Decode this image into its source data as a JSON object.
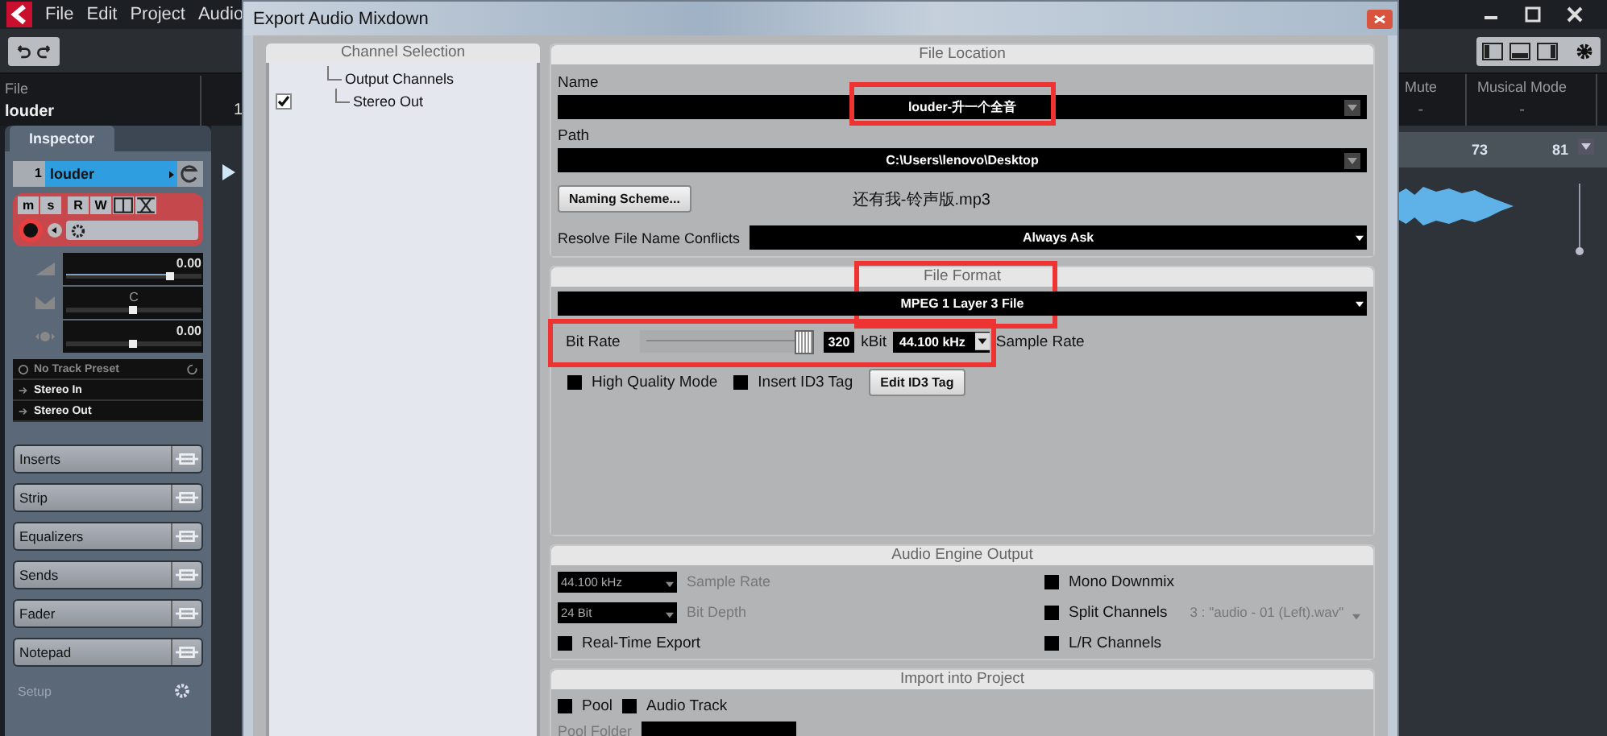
{
  "app": {
    "menu": [
      "File",
      "Edit",
      "Project",
      "Audio"
    ],
    "info": [
      {
        "label": "File",
        "value": "louder"
      }
    ],
    "info_partial": "1",
    "right_info": [
      {
        "label": "Mute",
        "value": "-"
      },
      {
        "label": "Musical Mode",
        "value": "-"
      }
    ],
    "ruler": [
      "73",
      "81"
    ],
    "inspector": {
      "tab": "Inspector",
      "track_number": "1",
      "track_name": "louder",
      "track_buttons": [
        "m",
        "s",
        "R",
        "W"
      ],
      "faders": [
        {
          "value": "0.00",
          "level": 0.77
        },
        {
          "value": "C",
          "level": 0.5
        },
        {
          "value": "0.00",
          "level": 0.5
        }
      ],
      "preset": "No Track Preset",
      "routing": [
        "Stereo In",
        "Stereo Out"
      ],
      "sections": [
        "Inserts",
        "Strip",
        "Equalizers",
        "Sends",
        "Fader",
        "Notepad"
      ],
      "setup": "Setup"
    }
  },
  "dialog": {
    "title": "Export Audio Mixdown",
    "channel_selection": {
      "title": "Channel Selection",
      "tree": [
        {
          "label": "Output Channels",
          "children": [
            {
              "label": "Stereo Out",
              "checked": true
            }
          ]
        }
      ]
    },
    "file_location": {
      "title": "File Location",
      "name_label": "Name",
      "name": "louder-升一个全音",
      "name_highlighted": true,
      "path_label": "Path",
      "path": "C:\\Users\\lenovo\\Desktop",
      "naming_button": "Naming Scheme...",
      "file_name": "还有我-铃声版.mp3",
      "conflict_label": "Resolve File Name Conflicts",
      "conflict": "Always Ask"
    },
    "file_format": {
      "title": "File Format",
      "highlighted": true,
      "format": "MPEG 1 Layer 3 File",
      "bit_rate_label": "Bit Rate",
      "bit_rate_highlighted": true,
      "bit_rate_slider": {
        "level": 1
      },
      "bit_rate": "320",
      "bit_rate_unit": "kBit",
      "sample_rate": "44.100 kHz",
      "sample_rate_label": "Sample Rate",
      "options": [
        {
          "label": "High Quality Mode",
          "checked": false
        },
        {
          "label": "Insert ID3 Tag",
          "checked": false
        }
      ],
      "id3_button": "Edit ID3 Tag"
    },
    "audio_engine": {
      "title": "Audio Engine Output",
      "sample_rate": "44.100 kHz",
      "sample_rate_label": "Sample Rate",
      "bit_depth": "24 Bit",
      "bit_depth_label": "Bit Depth",
      "real_time": {
        "label": "Real-Time Export",
        "checked": false
      },
      "mono": {
        "label": "Mono Downmix",
        "checked": false
      },
      "split": {
        "label": "Split Channels",
        "checked": false,
        "value": "3 : \"audio - 01 (Left).wav\""
      },
      "lr": {
        "label": "L/R Channels",
        "checked": false
      }
    },
    "import": {
      "title": "Import into Project",
      "pool": {
        "label": "Pool",
        "checked": false
      },
      "audio_track": {
        "label": "Audio Track",
        "checked": false
      },
      "pool_folder_label": "Pool Folder"
    }
  }
}
